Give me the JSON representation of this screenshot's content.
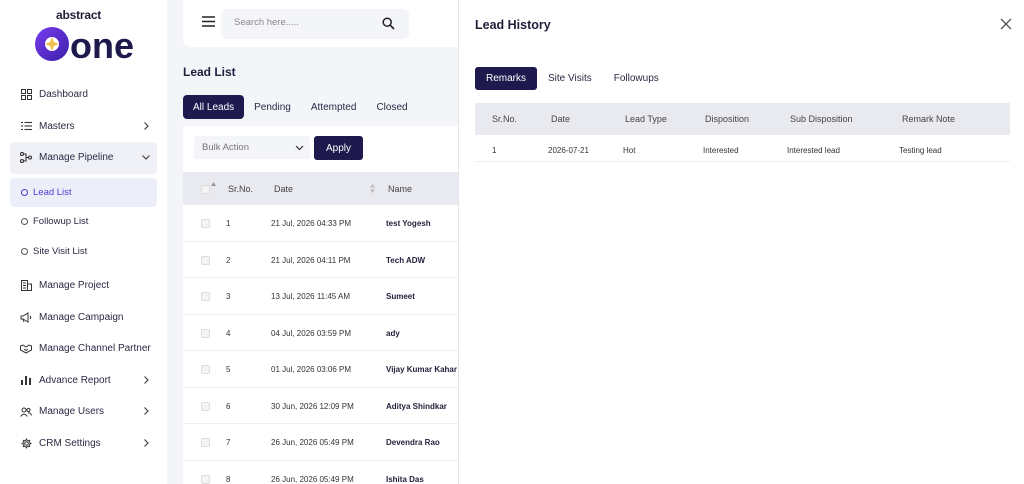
{
  "brand": {
    "top": "abstract",
    "main": "one"
  },
  "sidebar": {
    "items": [
      {
        "label": "Dashboard"
      },
      {
        "label": "Masters"
      },
      {
        "label": "Manage Pipeline"
      },
      {
        "label": "Manage Project"
      },
      {
        "label": "Manage Campaign"
      },
      {
        "label": "Manage Channel Partner"
      },
      {
        "label": "Advance Report"
      },
      {
        "label": "Manage Users"
      },
      {
        "label": "CRM Settings"
      }
    ],
    "pipeline_sub": [
      {
        "label": "Lead List"
      },
      {
        "label": "Followup List"
      },
      {
        "label": "Site Visit List"
      }
    ]
  },
  "search": {
    "placeholder": "Search here....."
  },
  "page": {
    "title": "Lead List"
  },
  "tabs": [
    "All Leads",
    "Pending",
    "Attempted",
    "Closed"
  ],
  "bulk": {
    "label": "Bulk Action",
    "apply": "Apply"
  },
  "table": {
    "headers": {
      "srno": "Sr.No.",
      "date": "Date",
      "name": "Name"
    },
    "rows": [
      {
        "srno": "1",
        "date": "21 Jul, 2026 04:33 PM",
        "name": "test Yogesh"
      },
      {
        "srno": "2",
        "date": "21 Jul, 2026 04:11 PM",
        "name": "Tech ADW"
      },
      {
        "srno": "3",
        "date": "13 Jul, 2026 11:45 AM",
        "name": "Sumeet"
      },
      {
        "srno": "4",
        "date": "04 Jul, 2026 03:59 PM",
        "name": "ady"
      },
      {
        "srno": "5",
        "date": "01 Jul, 2026 03:06 PM",
        "name": "Vijay Kumar Kahar"
      },
      {
        "srno": "6",
        "date": "30 Jun, 2026 12:09 PM",
        "name": "Aditya Shindkar"
      },
      {
        "srno": "7",
        "date": "26 Jun, 2026 05:49 PM",
        "name": "Devendra Rao"
      },
      {
        "srno": "8",
        "date": "26 Jun, 2026 05:49 PM",
        "name": "Ishita Das"
      }
    ]
  },
  "modal": {
    "title": "Lead History",
    "tabs": [
      "Remarks",
      "Site Visits",
      "Followups"
    ],
    "headers": {
      "srno": "Sr.No.",
      "date": "Date",
      "lead_type": "Lead Type",
      "disposition": "Disposition",
      "sub_disposition": "Sub Disposition",
      "remark": "Remark Note"
    },
    "rows": [
      {
        "srno": "1",
        "date": "2026-07-21",
        "lead_type": "Hot",
        "disposition": "Interested",
        "sub_disposition": "Interested lead",
        "remark": "Testing lead"
      }
    ]
  },
  "colors": {
    "primary": "#1e1a4d",
    "active_text": "#4b3fd1",
    "logo_purple": "#5b2bd6"
  }
}
